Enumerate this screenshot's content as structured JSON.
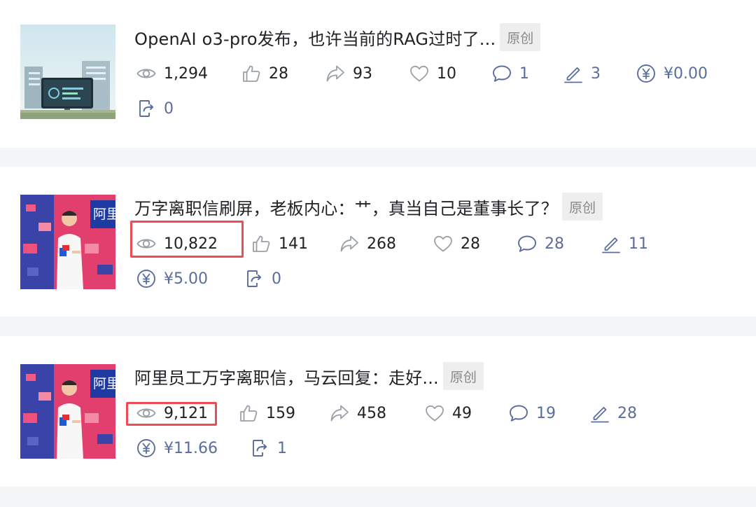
{
  "articles": [
    {
      "title": "OpenAI o3-pro发布，也许当前的RAG过时了...",
      "tag": "原创",
      "views": "1,294",
      "likes": "28",
      "shares": "93",
      "favorites": "10",
      "comments": "1",
      "edits": "3",
      "earnings": "¥0.00",
      "exports": "0",
      "thumbnail": "billboard-illustration",
      "views_highlighted": false
    },
    {
      "title": "万字离职信刷屏，老板内心：艹，真当自己是董事长了？",
      "tag": "原创",
      "views": "10,822",
      "likes": "141",
      "shares": "268",
      "favorites": "28",
      "comments": "28",
      "edits": "11",
      "earnings": "¥5.00",
      "exports": "0",
      "thumbnail": "speaker-on-stage-photo",
      "views_highlighted": true
    },
    {
      "title": "阿里员工万字离职信，马云回复：走好...",
      "tag": "原创",
      "views": "9,121",
      "likes": "159",
      "shares": "458",
      "favorites": "49",
      "comments": "19",
      "edits": "28",
      "earnings": "¥11.66",
      "exports": "1",
      "thumbnail": "speaker-on-stage-photo",
      "views_highlighted": true
    }
  ],
  "colors": {
    "text": "#222226",
    "blue_stat": "#5a6d9c",
    "icon_gray": "#9aa0a8",
    "highlight": "#ee4b55",
    "tag_bg": "#eeeeee",
    "page_bg": "#f4f5f7"
  }
}
